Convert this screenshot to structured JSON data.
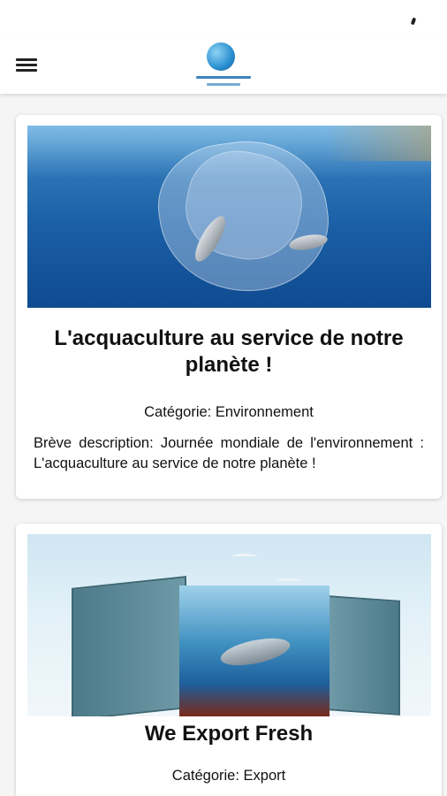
{
  "status_bar": {
    "indicator_icon": "signal-icon"
  },
  "app_bar": {
    "menu_icon": "hamburger-menu-icon",
    "logo_icon": "company-logo-globe"
  },
  "articles": [
    {
      "image": "ocean-plastic-bag-fish-image",
      "title": "L'acquaculture au service de notre planète !",
      "category": "Catégorie: Environnement",
      "description": "Brève description: Journée mondiale de l'environnement : L'acquaculture au service de notre planète !"
    },
    {
      "image": "shipping-container-ocean-image",
      "title": "We Export Fresh",
      "category": "Catégorie: Export"
    }
  ]
}
